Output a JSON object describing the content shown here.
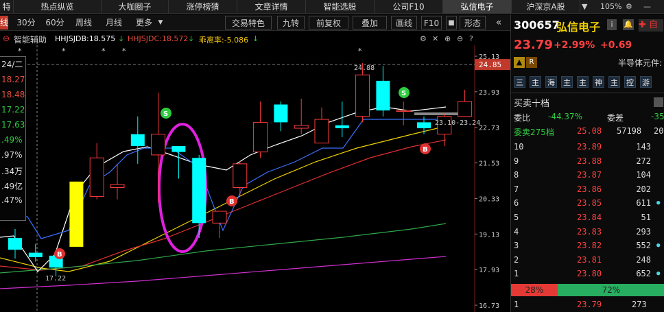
{
  "topbar": {
    "tabs": [
      "特估",
      "热点纵览",
      "大咖圈子",
      "涨停榜猜",
      "文章详情",
      "智能选股",
      "公司F10",
      "弘信电子",
      "沪深京A股"
    ],
    "active_tab": "弘信电子",
    "zoom": "105%"
  },
  "toolbar2": {
    "line_label": "线",
    "periods": [
      "30分",
      "60分",
      "周线",
      "月线",
      "更多"
    ],
    "tools": [
      "交易特色",
      "九转",
      "前复权",
      "叠加",
      "画线",
      "F10",
      "形态"
    ]
  },
  "indicators": {
    "label": "智能辅助",
    "hhjsjdb": "HHJSJDB:18.575",
    "hhjsjdc": "HHJSJDC:18.572",
    "deviation": "乖离率:-5.086"
  },
  "left_info": {
    "values": [
      "24/二",
      "18.27",
      "18.48",
      "17.22",
      "17.63",
      ".49%",
      ".97%",
      ".34万",
      ".49亿",
      ".47%"
    ]
  },
  "price_axis": {
    "ticks": [
      "25.13",
      "23.93",
      "22.73",
      "21.53",
      "20.33",
      "19.13",
      "17.93",
      "16.73"
    ],
    "current_price_tag": "24.85"
  },
  "chart_labels": {
    "high_label": "24.88",
    "low_label": "17.22",
    "range_label": "23.10-23.24",
    "buy_markers": [
      "B",
      "B",
      "B"
    ],
    "sell_markers": [
      "S",
      "S"
    ],
    "star_marker": "*"
  },
  "chart_data": {
    "type": "candlestick",
    "candles": [
      {
        "open": 19.0,
        "close": 18.6,
        "high": 19.3,
        "low": 18.3,
        "color": "cyan"
      },
      {
        "open": 18.5,
        "close": 18.35,
        "high": 18.8,
        "low": 18.2,
        "color": "cyan"
      },
      {
        "open": 18.4,
        "close": 18.0,
        "high": 18.6,
        "low": 17.7,
        "color": "cyan"
      },
      {
        "open": 18.7,
        "close": 20.9,
        "high": 20.9,
        "low": 18.7,
        "color": "yellow"
      },
      {
        "open": 20.4,
        "close": 21.7,
        "high": 22.2,
        "low": 20.3,
        "color": "red"
      },
      {
        "open": 20.8,
        "close": 20.7,
        "high": 21.5,
        "low": 20.3,
        "color": "red"
      },
      {
        "open": 22.1,
        "close": 22.5,
        "high": 23.1,
        "low": 21.5,
        "color": "cyan"
      },
      {
        "open": 22.5,
        "close": 21.8,
        "high": 23.9,
        "low": 20.2,
        "color": "red"
      },
      {
        "open": 21.9,
        "close": 22.1,
        "high": 22.1,
        "low": 21.0,
        "color": "cyan"
      },
      {
        "open": 21.7,
        "close": 19.5,
        "high": 21.8,
        "low": 19.0,
        "color": "cyan"
      },
      {
        "open": 19.5,
        "close": 19.9,
        "high": 19.9,
        "low": 19.0,
        "color": "red"
      },
      {
        "open": 20.7,
        "close": 21.5,
        "high": 21.6,
        "low": 20.4,
        "color": "red"
      },
      {
        "open": 21.9,
        "close": 22.9,
        "high": 23.6,
        "low": 21.7,
        "color": "red"
      },
      {
        "open": 22.9,
        "close": 23.5,
        "high": 23.6,
        "low": 22.6,
        "color": "cyan"
      },
      {
        "open": 22.7,
        "close": 22.8,
        "high": 23.7,
        "low": 22.5,
        "color": "red"
      },
      {
        "open": 22.2,
        "close": 23.0,
        "high": 23.4,
        "low": 22.2,
        "color": "red"
      },
      {
        "open": 22.7,
        "close": 22.8,
        "high": 23.6,
        "low": 22.4,
        "color": "cyan"
      },
      {
        "open": 23.1,
        "close": 24.5,
        "high": 24.9,
        "low": 22.9,
        "color": "red"
      },
      {
        "open": 24.3,
        "close": 23.3,
        "high": 24.8,
        "low": 23.1,
        "color": "cyan"
      },
      {
        "open": 23.3,
        "close": 23.3,
        "high": 23.6,
        "low": 22.8,
        "color": "red"
      },
      {
        "open": 22.9,
        "close": 22.7,
        "high": 23.1,
        "low": 22.5,
        "color": "cyan"
      },
      {
        "open": 22.5,
        "close": 23.1,
        "high": 23.2,
        "low": 22.1,
        "color": "red"
      },
      {
        "open": 23.1,
        "close": 23.6,
        "high": 24.0,
        "low": 23.1,
        "color": "red"
      }
    ],
    "ylim": [
      16.5,
      25.5
    ]
  },
  "stock": {
    "code": "300657",
    "name": "弘信电子",
    "price": "23.79",
    "change_pct": "+2.99%",
    "change": "+0.69",
    "sector": "半导体元件:",
    "badges": [
      "R"
    ],
    "function_buttons": [
      "三",
      "主",
      "海",
      "主",
      "主",
      "神",
      "主",
      "控",
      "游"
    ]
  },
  "orderbook": {
    "title": "买卖十档",
    "ratio_label": "委比",
    "ratio_value": "-44.37%",
    "diff_label": "委差",
    "diff_value": "-35",
    "sell_summary_label": "委卖275档",
    "sell_summary_price": "25.08",
    "sell_summary_vol": "57198",
    "sell_summary_extra": "20",
    "rows": [
      {
        "level": "10",
        "price": "23.89",
        "vol": "143"
      },
      {
        "level": "9",
        "price": "23.88",
        "vol": "272"
      },
      {
        "level": "8",
        "price": "23.87",
        "vol": "104"
      },
      {
        "level": "7",
        "price": "23.86",
        "vol": "202"
      },
      {
        "level": "6",
        "price": "23.85",
        "vol": "611"
      },
      {
        "level": "5",
        "price": "23.84",
        "vol": "51"
      },
      {
        "level": "4",
        "price": "23.83",
        "vol": "293"
      },
      {
        "level": "3",
        "price": "23.82",
        "vol": "552"
      },
      {
        "level": "2",
        "price": "23.81",
        "vol": "248"
      },
      {
        "level": "1",
        "price": "23.80",
        "vol": "652"
      }
    ],
    "buy_pct": "28%",
    "sell_pct": "72%",
    "buy1": {
      "level": "1",
      "price": "23.79",
      "vol": "273"
    }
  }
}
